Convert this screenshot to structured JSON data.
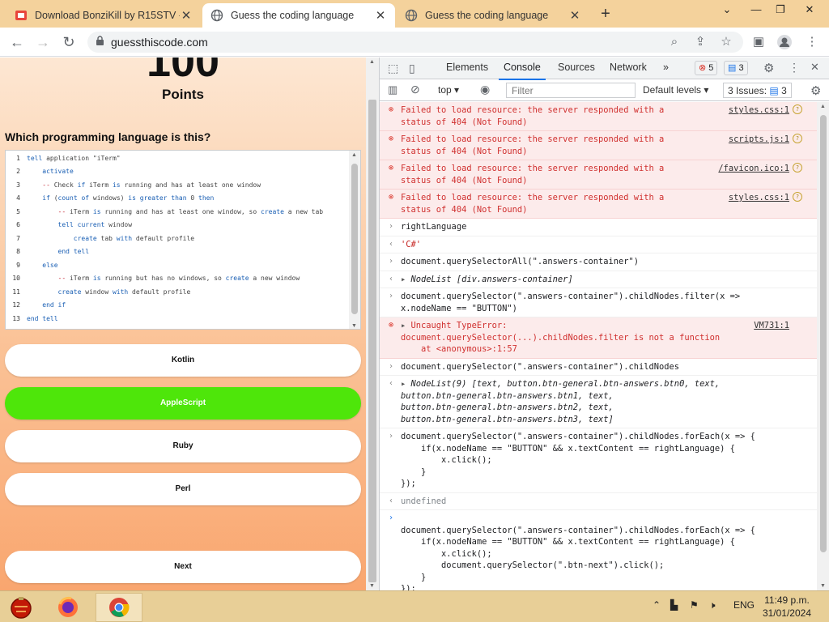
{
  "browser": {
    "tabs": [
      {
        "title": "Download BonziKill by R15STV -",
        "active": false,
        "icon": "download-site-icon"
      },
      {
        "title": "Guess the coding language",
        "active": true,
        "icon": "globe-icon"
      },
      {
        "title": "Guess the coding language",
        "active": false,
        "icon": "globe-icon"
      }
    ],
    "new_tab": "+",
    "url": "guessthiscode.com"
  },
  "page": {
    "points_value": "100",
    "points_label": "Points",
    "question": "Which programming language is this?",
    "code_lines": [
      {
        "n": "1",
        "text": "tell application \"iTerm\""
      },
      {
        "n": "2",
        "text": "    activate"
      },
      {
        "n": "3",
        "text": "    -- Check if iTerm is running and has at least one window"
      },
      {
        "n": "4",
        "text": "    if (count of windows) is greater than 0 then"
      },
      {
        "n": "5",
        "text": "        -- iTerm is running and has at least one window, so create a new tab"
      },
      {
        "n": "6",
        "text": "        tell current window"
      },
      {
        "n": "7",
        "text": "            create tab with default profile"
      },
      {
        "n": "8",
        "text": "        end tell"
      },
      {
        "n": "9",
        "text": "    else"
      },
      {
        "n": "10",
        "text": "        -- iTerm is running but has no windows, so create a new window"
      },
      {
        "n": "11",
        "text": "        create window with default profile"
      },
      {
        "n": "12",
        "text": "    end if"
      },
      {
        "n": "13",
        "text": "end tell"
      }
    ],
    "answers": [
      {
        "label": "Kotlin",
        "correct": false
      },
      {
        "label": "AppleScript",
        "correct": true
      },
      {
        "label": "Ruby",
        "correct": false
      },
      {
        "label": "Perl",
        "correct": false
      }
    ],
    "next_label": "Next"
  },
  "devtools": {
    "tabs": [
      "Elements",
      "Console",
      "Sources",
      "Network"
    ],
    "active_tab": "Console",
    "more_tabs": "»",
    "error_count": "5",
    "message_count": "3",
    "context": "top",
    "filter_placeholder": "Filter",
    "levels": "Default levels",
    "issues_label": "3 Issues:",
    "issues_count": "3"
  },
  "console": [
    {
      "kind": "error",
      "text": "Failed to load resource: the server responded with a\nstatus of 404 (Not Found)",
      "source": "styles.css:1"
    },
    {
      "kind": "error",
      "text": "Failed to load resource: the server responded with a\nstatus of 404 (Not Found)",
      "source": "scripts.js:1"
    },
    {
      "kind": "error",
      "text": "Failed to load resource: the server responded with a\nstatus of 404 (Not Found)",
      "source": "/favicon.ico:1"
    },
    {
      "kind": "error",
      "text": "Failed to load resource: the server responded with a\nstatus of 404 (Not Found)",
      "source": "styles.css:1"
    },
    {
      "kind": "input",
      "text": "rightLanguage"
    },
    {
      "kind": "result-str",
      "text": "'C#'"
    },
    {
      "kind": "input",
      "text": "document.querySelectorAll(\".answers-container\")"
    },
    {
      "kind": "result-obj",
      "text": "NodeList [div.answers-container]"
    },
    {
      "kind": "input",
      "text": "document.querySelector(\".answers-container\").childNodes.filter(x =>\nx.nodeName == \"BUTTON\")"
    },
    {
      "kind": "error-obj",
      "text": "Uncaught TypeError:\ndocument.querySelector(...).childNodes.filter is not a function\n    at <anonymous>:1:57",
      "source": "VM731:1"
    },
    {
      "kind": "input",
      "text": "document.querySelector(\".answers-container\").childNodes"
    },
    {
      "kind": "result-obj",
      "text": "NodeList(9) [text, button.btn-general.btn-answers.btn0, text,\nbutton.btn-general.btn-answers.btn1, text,\nbutton.btn-general.btn-answers.btn2, text,\nbutton.btn-general.btn-answers.btn3, text]"
    },
    {
      "kind": "input",
      "text": "document.querySelector(\".answers-container\").childNodes.forEach(x => {\n    if(x.nodeName == \"BUTTON\" && x.textContent == rightLanguage) {\n        x.click();\n    }\n});"
    },
    {
      "kind": "result-undef",
      "text": "undefined"
    },
    {
      "kind": "prompt",
      "text": "\ndocument.querySelector(\".answers-container\").childNodes.forEach(x => {\n    if(x.nodeName == \"BUTTON\" && x.textContent == rightLanguage) {\n        x.click();\n        document.querySelector(\".btn-next\").click();\n    }\n});"
    }
  ],
  "taskbar": {
    "language": "ENG",
    "time": "11:49 p.m.",
    "date": "31/01/2024"
  },
  "colors": {
    "tab_strip": "#f4d29c",
    "correct_answer": "#4ee60a",
    "error_text": "#d0302f",
    "accent": "#1a73e8",
    "taskbar": "#e8cf97"
  }
}
